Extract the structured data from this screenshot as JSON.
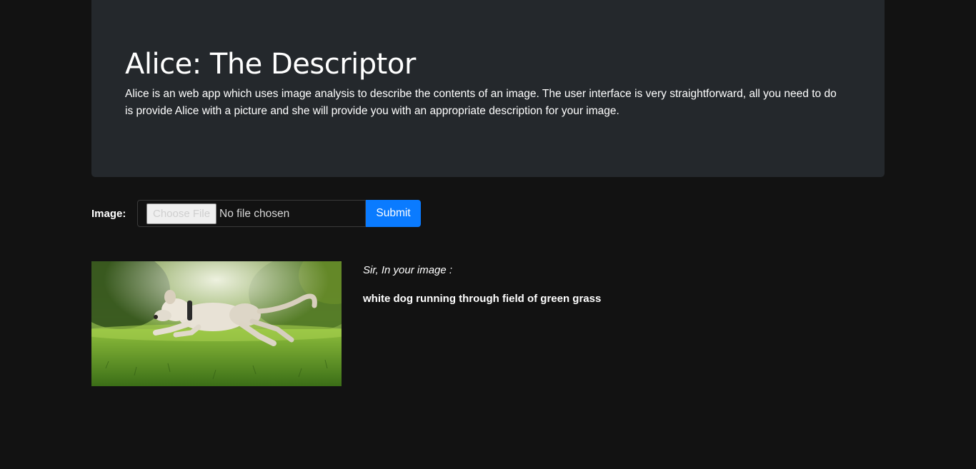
{
  "header": {
    "title": "Alice: The Descriptor",
    "description": "Alice is an web app which uses image analysis to describe the contents of an image. The user interface is very straightforward, all you need to do is provide Alice with a picture and she will provide you with an appropriate description for your image."
  },
  "form": {
    "label": "Image:",
    "choose_file_label": "Choose File",
    "file_status": "No file chosen",
    "submit_label": "Submit"
  },
  "result": {
    "image_icon": "photo-white-dog-running-on-grass",
    "intro": "Sir, In your image :",
    "caption": "white dog running through field of green grass"
  },
  "colors": {
    "page_bg": "#121212",
    "jumbotron_bg": "#24282c",
    "accent": "#0a7bff"
  }
}
